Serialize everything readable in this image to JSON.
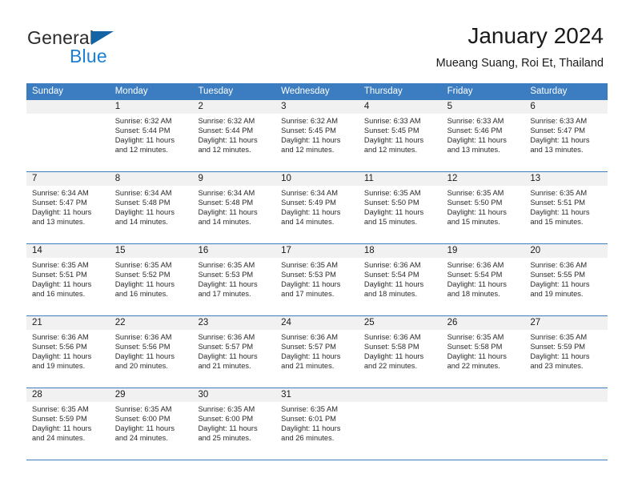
{
  "brand": {
    "word_general": "General",
    "word_blue": "Blue",
    "logo_icon": "triangle-logo-icon",
    "accent_color": "#1464a5"
  },
  "header": {
    "title": "January 2024",
    "subtitle": "Mueang Suang, Roi Et, Thailand"
  },
  "calendar": {
    "header_color": "#3b7dc0",
    "daynum_bg": "#f1f1f1",
    "weekdays": [
      "Sunday",
      "Monday",
      "Tuesday",
      "Wednesday",
      "Thursday",
      "Friday",
      "Saturday"
    ],
    "weeks": [
      [
        {
          "day": "",
          "lines": []
        },
        {
          "day": "1",
          "lines": [
            "Sunrise: 6:32 AM",
            "Sunset: 5:44 PM",
            "Daylight: 11 hours",
            "and 12 minutes."
          ]
        },
        {
          "day": "2",
          "lines": [
            "Sunrise: 6:32 AM",
            "Sunset: 5:44 PM",
            "Daylight: 11 hours",
            "and 12 minutes."
          ]
        },
        {
          "day": "3",
          "lines": [
            "Sunrise: 6:32 AM",
            "Sunset: 5:45 PM",
            "Daylight: 11 hours",
            "and 12 minutes."
          ]
        },
        {
          "day": "4",
          "lines": [
            "Sunrise: 6:33 AM",
            "Sunset: 5:45 PM",
            "Daylight: 11 hours",
            "and 12 minutes."
          ]
        },
        {
          "day": "5",
          "lines": [
            "Sunrise: 6:33 AM",
            "Sunset: 5:46 PM",
            "Daylight: 11 hours",
            "and 13 minutes."
          ]
        },
        {
          "day": "6",
          "lines": [
            "Sunrise: 6:33 AM",
            "Sunset: 5:47 PM",
            "Daylight: 11 hours",
            "and 13 minutes."
          ]
        }
      ],
      [
        {
          "day": "7",
          "lines": [
            "Sunrise: 6:34 AM",
            "Sunset: 5:47 PM",
            "Daylight: 11 hours",
            "and 13 minutes."
          ]
        },
        {
          "day": "8",
          "lines": [
            "Sunrise: 6:34 AM",
            "Sunset: 5:48 PM",
            "Daylight: 11 hours",
            "and 14 minutes."
          ]
        },
        {
          "day": "9",
          "lines": [
            "Sunrise: 6:34 AM",
            "Sunset: 5:48 PM",
            "Daylight: 11 hours",
            "and 14 minutes."
          ]
        },
        {
          "day": "10",
          "lines": [
            "Sunrise: 6:34 AM",
            "Sunset: 5:49 PM",
            "Daylight: 11 hours",
            "and 14 minutes."
          ]
        },
        {
          "day": "11",
          "lines": [
            "Sunrise: 6:35 AM",
            "Sunset: 5:50 PM",
            "Daylight: 11 hours",
            "and 15 minutes."
          ]
        },
        {
          "day": "12",
          "lines": [
            "Sunrise: 6:35 AM",
            "Sunset: 5:50 PM",
            "Daylight: 11 hours",
            "and 15 minutes."
          ]
        },
        {
          "day": "13",
          "lines": [
            "Sunrise: 6:35 AM",
            "Sunset: 5:51 PM",
            "Daylight: 11 hours",
            "and 15 minutes."
          ]
        }
      ],
      [
        {
          "day": "14",
          "lines": [
            "Sunrise: 6:35 AM",
            "Sunset: 5:51 PM",
            "Daylight: 11 hours",
            "and 16 minutes."
          ]
        },
        {
          "day": "15",
          "lines": [
            "Sunrise: 6:35 AM",
            "Sunset: 5:52 PM",
            "Daylight: 11 hours",
            "and 16 minutes."
          ]
        },
        {
          "day": "16",
          "lines": [
            "Sunrise: 6:35 AM",
            "Sunset: 5:53 PM",
            "Daylight: 11 hours",
            "and 17 minutes."
          ]
        },
        {
          "day": "17",
          "lines": [
            "Sunrise: 6:35 AM",
            "Sunset: 5:53 PM",
            "Daylight: 11 hours",
            "and 17 minutes."
          ]
        },
        {
          "day": "18",
          "lines": [
            "Sunrise: 6:36 AM",
            "Sunset: 5:54 PM",
            "Daylight: 11 hours",
            "and 18 minutes."
          ]
        },
        {
          "day": "19",
          "lines": [
            "Sunrise: 6:36 AM",
            "Sunset: 5:54 PM",
            "Daylight: 11 hours",
            "and 18 minutes."
          ]
        },
        {
          "day": "20",
          "lines": [
            "Sunrise: 6:36 AM",
            "Sunset: 5:55 PM",
            "Daylight: 11 hours",
            "and 19 minutes."
          ]
        }
      ],
      [
        {
          "day": "21",
          "lines": [
            "Sunrise: 6:36 AM",
            "Sunset: 5:56 PM",
            "Daylight: 11 hours",
            "and 19 minutes."
          ]
        },
        {
          "day": "22",
          "lines": [
            "Sunrise: 6:36 AM",
            "Sunset: 5:56 PM",
            "Daylight: 11 hours",
            "and 20 minutes."
          ]
        },
        {
          "day": "23",
          "lines": [
            "Sunrise: 6:36 AM",
            "Sunset: 5:57 PM",
            "Daylight: 11 hours",
            "and 21 minutes."
          ]
        },
        {
          "day": "24",
          "lines": [
            "Sunrise: 6:36 AM",
            "Sunset: 5:57 PM",
            "Daylight: 11 hours",
            "and 21 minutes."
          ]
        },
        {
          "day": "25",
          "lines": [
            "Sunrise: 6:36 AM",
            "Sunset: 5:58 PM",
            "Daylight: 11 hours",
            "and 22 minutes."
          ]
        },
        {
          "day": "26",
          "lines": [
            "Sunrise: 6:35 AM",
            "Sunset: 5:58 PM",
            "Daylight: 11 hours",
            "and 22 minutes."
          ]
        },
        {
          "day": "27",
          "lines": [
            "Sunrise: 6:35 AM",
            "Sunset: 5:59 PM",
            "Daylight: 11 hours",
            "and 23 minutes."
          ]
        }
      ],
      [
        {
          "day": "28",
          "lines": [
            "Sunrise: 6:35 AM",
            "Sunset: 5:59 PM",
            "Daylight: 11 hours",
            "and 24 minutes."
          ]
        },
        {
          "day": "29",
          "lines": [
            "Sunrise: 6:35 AM",
            "Sunset: 6:00 PM",
            "Daylight: 11 hours",
            "and 24 minutes."
          ]
        },
        {
          "day": "30",
          "lines": [
            "Sunrise: 6:35 AM",
            "Sunset: 6:00 PM",
            "Daylight: 11 hours",
            "and 25 minutes."
          ]
        },
        {
          "day": "31",
          "lines": [
            "Sunrise: 6:35 AM",
            "Sunset: 6:01 PM",
            "Daylight: 11 hours",
            "and 26 minutes."
          ]
        },
        {
          "day": "",
          "lines": []
        },
        {
          "day": "",
          "lines": []
        },
        {
          "day": "",
          "lines": []
        }
      ]
    ]
  }
}
